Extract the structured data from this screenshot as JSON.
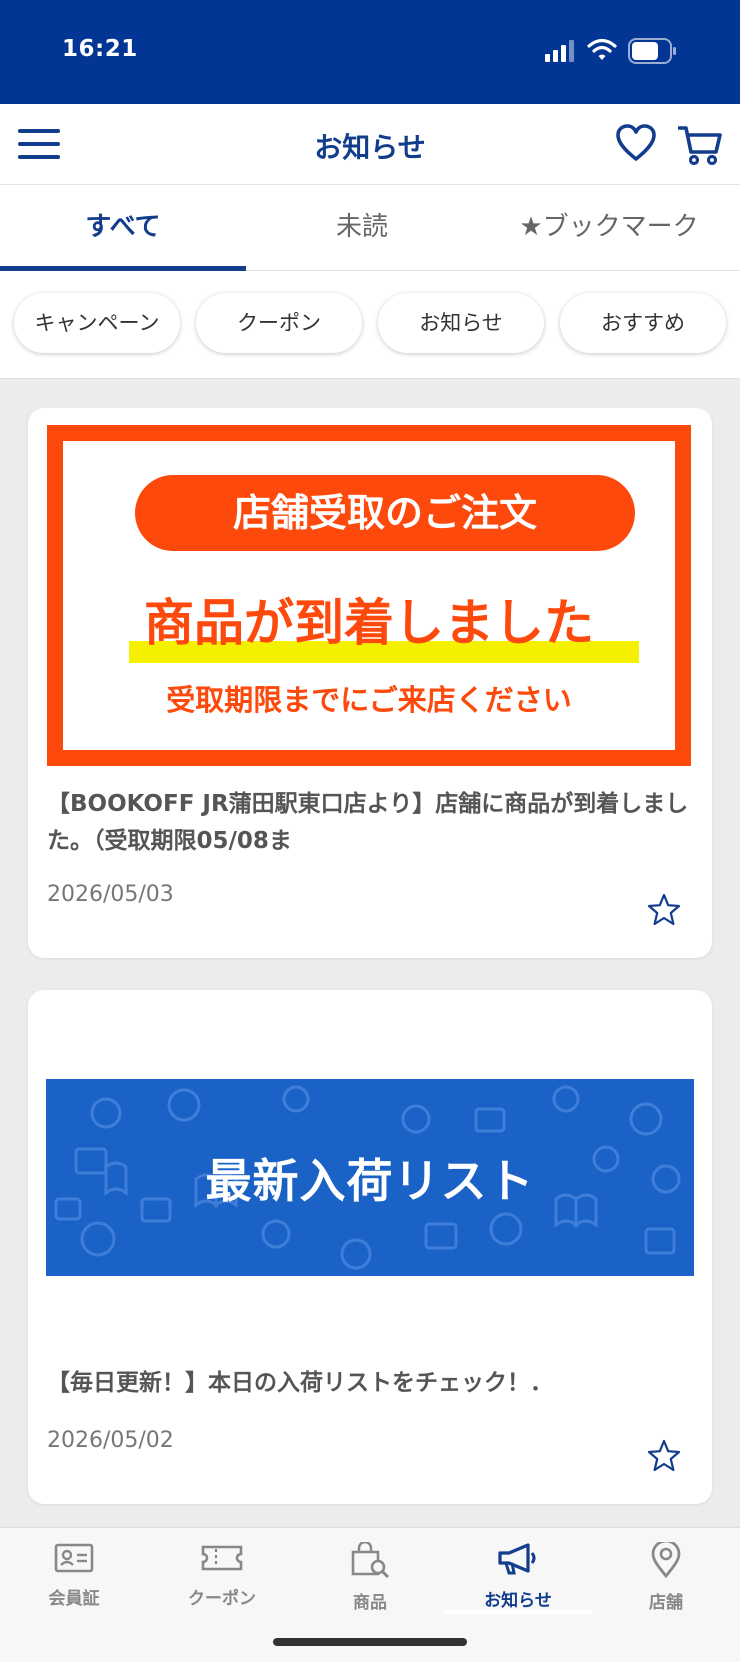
{
  "status": {
    "time": "16:21"
  },
  "header": {
    "title": "お知らせ",
    "menu_icon": "hamburger-icon",
    "favorite_icon": "heart-icon",
    "cart_icon": "cart-icon"
  },
  "tabs": [
    {
      "label": "すべて",
      "active": true
    },
    {
      "label": "未読",
      "active": false
    },
    {
      "label": "★ブックマーク",
      "active": false
    }
  ],
  "filters": [
    "キャンペーン",
    "クーポン",
    "お知らせ",
    "おすすめ"
  ],
  "notices": [
    {
      "banner": {
        "pill_text": "店舗受取のご注文",
        "headline": "商品が到着しました",
        "subline": "受取期限までにご来店ください"
      },
      "title": "【BOOKOFF JR蒲田駅東口店より】店舗に商品が到着しました。（受取期限05/08ま",
      "date": "2026/05/03"
    },
    {
      "banner": {
        "text": "最新入荷リスト"
      },
      "title": "【毎日更新！】本日の入荷リストをチェック！．",
      "date": "2026/05/02"
    }
  ],
  "bottom_nav": [
    {
      "label": "会員証",
      "icon": "member-card-icon",
      "active": false
    },
    {
      "label": "クーポン",
      "icon": "ticket-icon",
      "active": false
    },
    {
      "label": "商品",
      "icon": "shopping-bag-search-icon",
      "active": false
    },
    {
      "label": "お知らせ",
      "icon": "megaphone-icon",
      "active": true
    },
    {
      "label": "店舗",
      "icon": "location-pin-icon",
      "active": false
    }
  ],
  "colors": {
    "brand": "#033694",
    "accent": "#123c8c",
    "orange": "#fd4a0c",
    "highlight": "#f5f000",
    "banner_blue": "#1b62c7"
  }
}
